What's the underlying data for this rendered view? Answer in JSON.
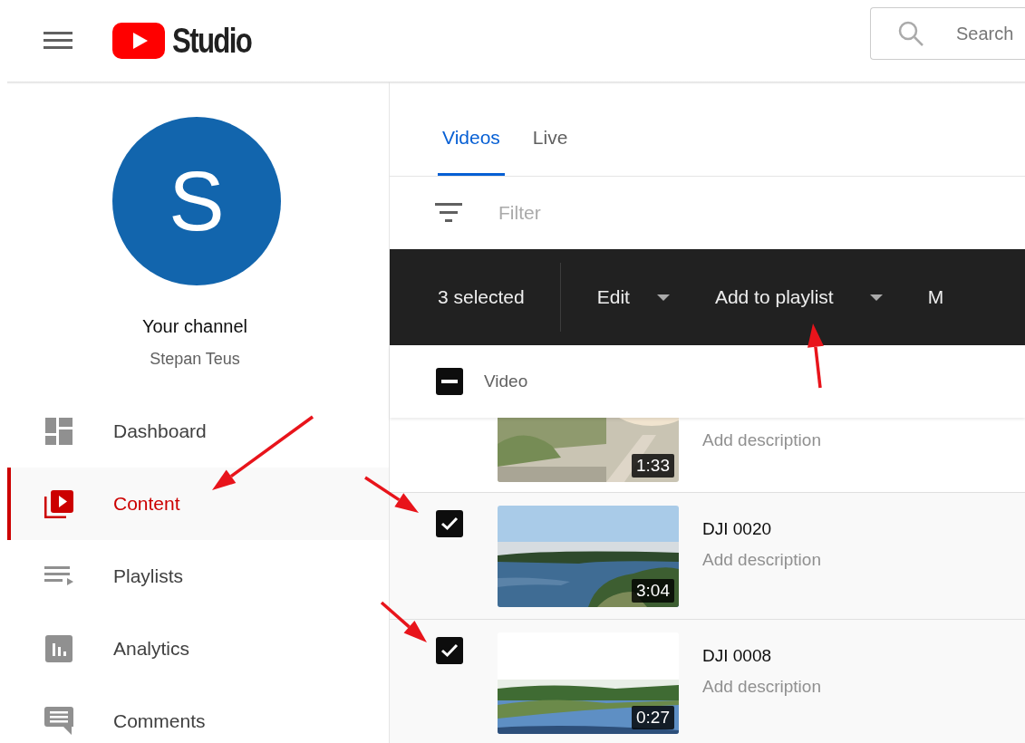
{
  "header": {
    "logo_text": "Studio",
    "search": {
      "placeholder": "Search"
    }
  },
  "sidebar": {
    "avatar_letter": "S",
    "channel_label": "Your channel",
    "channel_name": "Stepan Teus",
    "items": [
      {
        "kind": "dashboard",
        "label": "Dashboard",
        "selected": false
      },
      {
        "kind": "content",
        "label": "Content",
        "selected": true
      },
      {
        "kind": "playlists",
        "label": "Playlists",
        "selected": false
      },
      {
        "kind": "analytics",
        "label": "Analytics",
        "selected": false
      },
      {
        "kind": "comments",
        "label": "Comments",
        "selected": false
      }
    ]
  },
  "tabs": [
    {
      "label": "Videos",
      "selected": true
    },
    {
      "label": "Live",
      "selected": false
    }
  ],
  "filter": {
    "placeholder": "Filter"
  },
  "selection_bar": {
    "count": "3 selected",
    "actions": [
      {
        "label": "Edit",
        "dropdown": true
      },
      {
        "label": "Add to playlist",
        "dropdown": true
      },
      {
        "label": "M",
        "dropdown": false
      }
    ]
  },
  "table": {
    "column": "Video",
    "header_checkbox_indeterminate": true,
    "rows": [
      {
        "description": "Add description",
        "duration": "1:33"
      },
      {
        "title": "DJI 0020",
        "description": "Add description",
        "duration": "3:04",
        "checked": true
      },
      {
        "title": "DJI 0008",
        "description": "Add description",
        "duration": "0:27",
        "checked": true
      }
    ]
  }
}
